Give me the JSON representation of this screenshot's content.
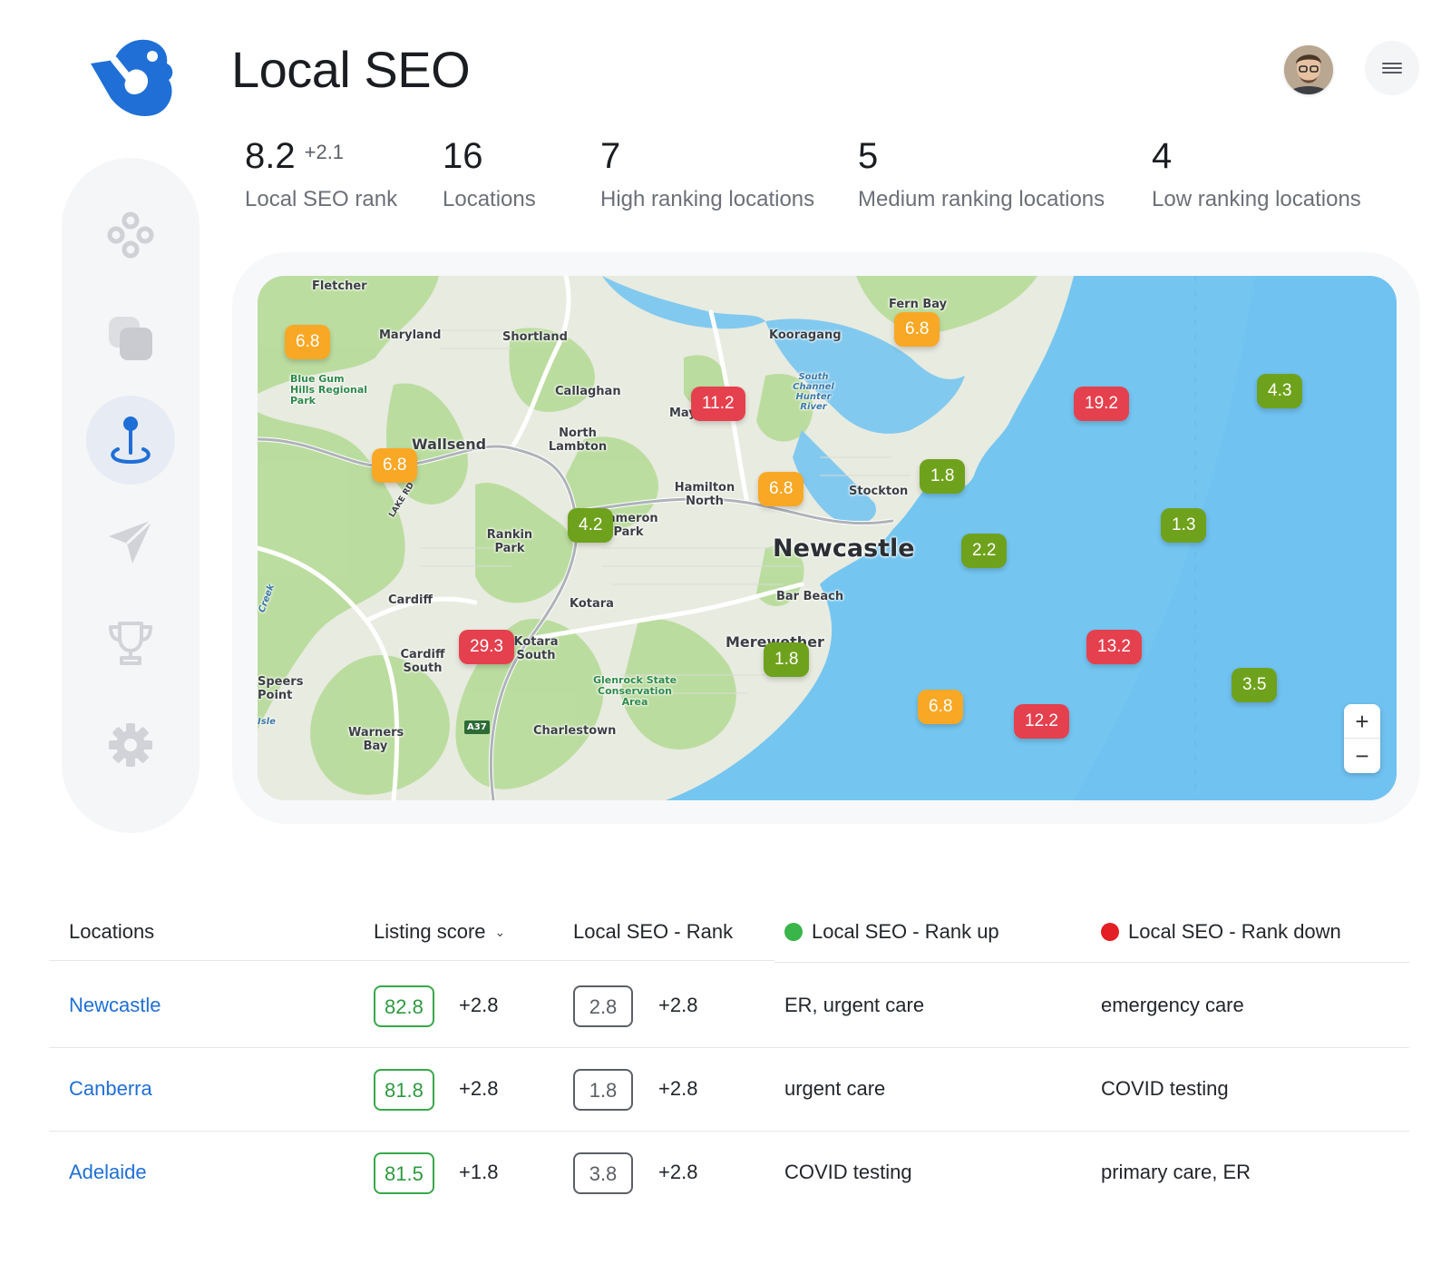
{
  "header": {
    "title": "Local SEO",
    "logo_icon": "brand-logo-icon",
    "avatar_icon": "user-avatar",
    "menu_icon": "hamburger-menu-icon"
  },
  "stats": [
    {
      "value": "8.2",
      "delta": "+2.1",
      "label": "Local SEO rank"
    },
    {
      "value": "16",
      "delta": "",
      "label": "Locations"
    },
    {
      "value": "7",
      "delta": "",
      "label": "High ranking locations"
    },
    {
      "value": "5",
      "delta": "",
      "label": "Medium ranking locations"
    },
    {
      "value": "4",
      "delta": "",
      "label": "Low ranking locations"
    }
  ],
  "sidebar": {
    "items": [
      {
        "icon": "dashboard-circles-icon",
        "active": false
      },
      {
        "icon": "layers-icon",
        "active": false
      },
      {
        "icon": "location-pin-icon",
        "active": true
      },
      {
        "icon": "send-icon",
        "active": false
      },
      {
        "icon": "trophy-icon",
        "active": false
      },
      {
        "icon": "gear-icon",
        "active": false
      }
    ]
  },
  "map": {
    "places": [
      "Fletcher",
      "Maryland",
      "Shortland",
      "Fern Bay",
      "Kooragang",
      "Blue Gum Hills Regional Park",
      "Callaghan",
      "North Lambton",
      "Mayfield",
      "Wallsend",
      "Hamilton North",
      "Stockton",
      "LAKE RD",
      "Cameron Park",
      "Rankin Park",
      "Newcastle",
      "Bar Beach",
      "Cardiff",
      "Kotara",
      "Kotara South",
      "Cardiff South",
      "Merewether",
      "Speers Point",
      "Glenrock State Conservation Area",
      "Warners Bay",
      "Charlestown",
      "A37",
      "South Channel Hunter River",
      "Creek",
      "Isle"
    ],
    "pins": [
      {
        "value": "6.8",
        "level": "orange"
      },
      {
        "value": "6.8",
        "level": "orange"
      },
      {
        "value": "11.2",
        "level": "red"
      },
      {
        "value": "19.2",
        "level": "red"
      },
      {
        "value": "4.3",
        "level": "green"
      },
      {
        "value": "6.8",
        "level": "orange"
      },
      {
        "value": "6.8",
        "level": "orange"
      },
      {
        "value": "1.8",
        "level": "green"
      },
      {
        "value": "4.2",
        "level": "green"
      },
      {
        "value": "1.3",
        "level": "green"
      },
      {
        "value": "2.2",
        "level": "green"
      },
      {
        "value": "29.3",
        "level": "red"
      },
      {
        "value": "13.2",
        "level": "red"
      },
      {
        "value": "1.8",
        "level": "green"
      },
      {
        "value": "3.5",
        "level": "green"
      },
      {
        "value": "6.8",
        "level": "orange"
      },
      {
        "value": "12.2",
        "level": "red"
      }
    ],
    "zoom_in": "+",
    "zoom_out": "−"
  },
  "colors": {
    "orange": "#f9a825",
    "red": "#e5404e",
    "green": "#6fa21c",
    "link": "#1f6fd6",
    "score_border": "#37a84a"
  },
  "table": {
    "columns": [
      "Locations",
      "Listing score",
      "Local SEO - Rank",
      "Local SEO - Rank up",
      "Local SEO - Rank down"
    ],
    "sort_icon": "chevron-down-icon",
    "rows": [
      {
        "location": "Newcastle",
        "score": "82.8",
        "score_delta": "+2.8",
        "rank": "2.8",
        "rank_delta": "+2.8",
        "rank_up": "ER, urgent care",
        "rank_down": "emergency care"
      },
      {
        "location": "Canberra",
        "score": "81.8",
        "score_delta": "+2.8",
        "rank": "1.8",
        "rank_delta": "+2.8",
        "rank_up": "urgent care",
        "rank_down": "COVID testing"
      },
      {
        "location": "Adelaide",
        "score": "81.5",
        "score_delta": "+1.8",
        "rank": "3.8",
        "rank_delta": "+2.8",
        "rank_up": "COVID testing",
        "rank_down": "primary care, ER"
      }
    ]
  }
}
